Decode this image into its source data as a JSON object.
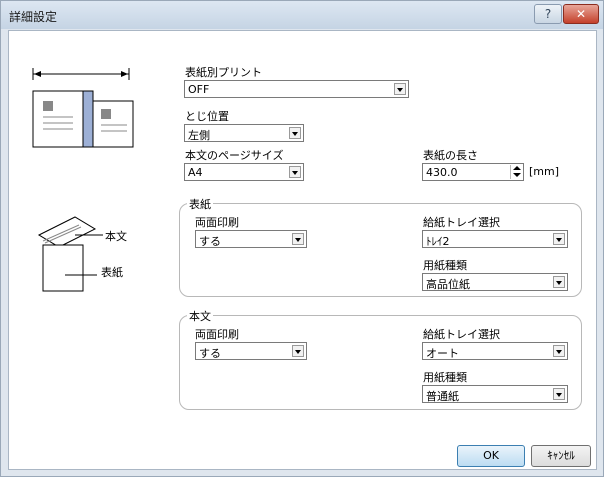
{
  "window": {
    "title": "詳細設定"
  },
  "left_panel": {
    "label_honbun": "本文",
    "label_hyoushi": "表紙"
  },
  "print_by_cover": {
    "label": "表紙別プリント",
    "value": "OFF"
  },
  "binding": {
    "label": "とじ位置",
    "value": "左側"
  },
  "page_size": {
    "label": "本文のページサイズ",
    "value": "A4"
  },
  "cover_length": {
    "label": "表紙の長さ",
    "value": "430.0",
    "unit": "[mm]"
  },
  "cover_group": {
    "title": "表紙",
    "duplex_label": "両面印刷",
    "duplex_value": "する",
    "tray_label": "給紙トレイ選択",
    "tray_value": "ﾄﾚｲ2",
    "paper_label": "用紙種類",
    "paper_value": "高品位紙"
  },
  "body_group": {
    "title": "本文",
    "duplex_label": "両面印刷",
    "duplex_value": "する",
    "tray_label": "給紙トレイ選択",
    "tray_value": "オート",
    "paper_label": "用紙種類",
    "paper_value": "普通紙"
  },
  "buttons": {
    "ok": "OK",
    "cancel": "ｷｬﾝｾﾙ"
  },
  "colors": {
    "title_bg": "#c5d4e4",
    "close_bg": "#c4402a",
    "ok_border": "#3c7fb1"
  },
  "icons": [
    "help-icon",
    "close-icon",
    "double-arrow-icon",
    "booklet-icon",
    "cover-book-icon"
  ]
}
